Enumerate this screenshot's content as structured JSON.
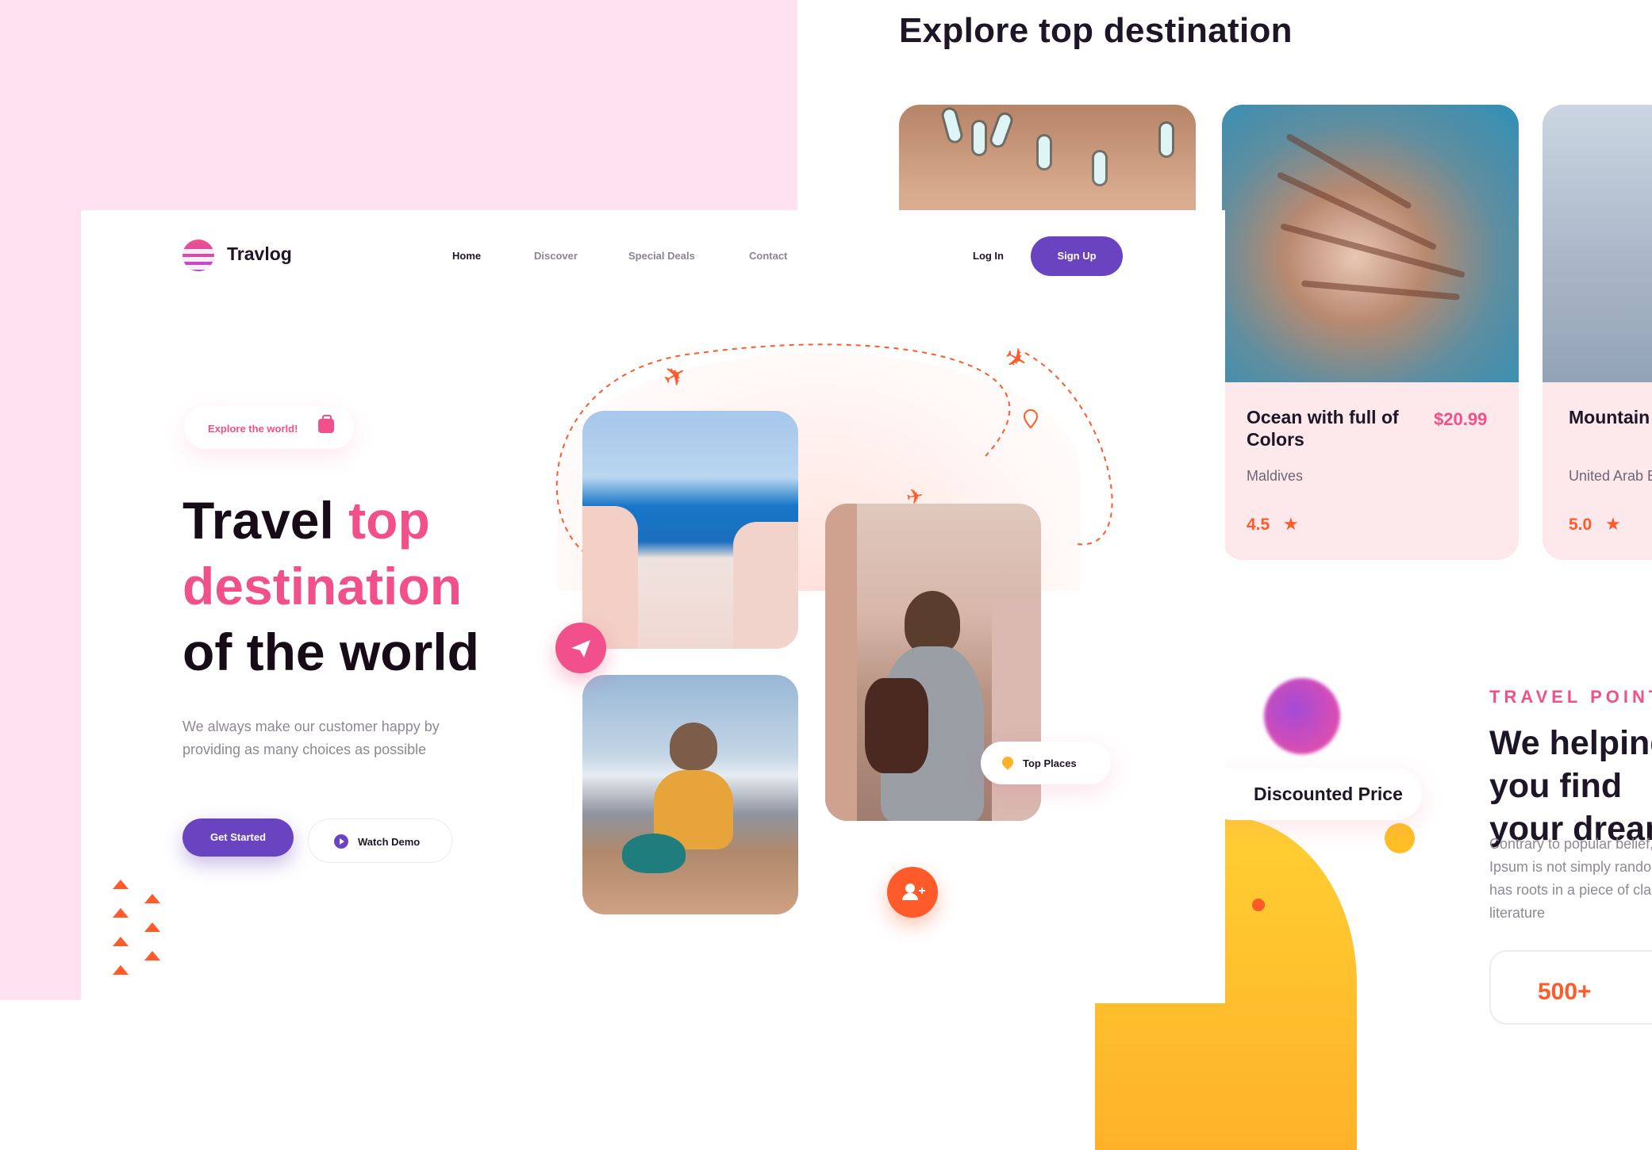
{
  "canvas": {
    "explore_title": "Explore top destination",
    "cards": [
      {
        "title": "Ocean with full of Colors",
        "location": "Maldives",
        "price": "$20.99",
        "rating": "4.5"
      },
      {
        "title": "Mountain View, Above the Cloud",
        "location": "United Arab Emirates",
        "rating": "5.0"
      }
    ],
    "travel_point": "TRAVEL POINT",
    "we_help": "We helping you find your dream",
    "contrary": "Contrary to popular belief, Lorem Ipsum is not simply random text. It has roots in a piece of classical Latin literature",
    "discounted_price": "Discounted Price",
    "count_value": "500+"
  },
  "site": {
    "brand": "Travlog",
    "nav": [
      "Home",
      "Discover",
      "Special Deals",
      "Contact"
    ],
    "login": "Log In",
    "signup": "Sign Up",
    "explore_pill": "Explore the world!",
    "hero": {
      "line1_a": "Travel ",
      "line1_b": "top",
      "line2": "destination",
      "line3": "of the world"
    },
    "subtext": "We always make our customer happy by providing as many choices as possible",
    "get_started": "Get Started",
    "watch_demo": "Watch Demo",
    "top_places": "Top Places"
  },
  "colors": {
    "accent_pink": "#f2508a",
    "accent_purple": "#6a43c1",
    "accent_orange": "#ff5a2a",
    "bg_pink": "#ffe1f0"
  }
}
